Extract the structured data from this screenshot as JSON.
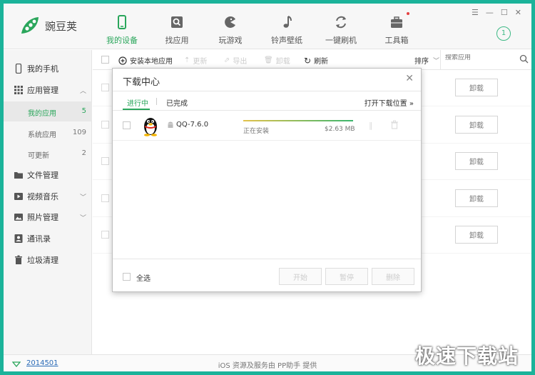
{
  "app": {
    "name": "豌豆荚"
  },
  "nav": {
    "tabs": [
      {
        "label": "我的设备",
        "icon": "phone-icon"
      },
      {
        "label": "找应用",
        "icon": "app-search-icon"
      },
      {
        "label": "玩游戏",
        "icon": "game-pacman-icon"
      },
      {
        "label": "铃声壁纸",
        "icon": "music-note-icon"
      },
      {
        "label": "一键刷机",
        "icon": "refresh-flash-icon"
      },
      {
        "label": "工具箱",
        "icon": "toolbox-icon"
      }
    ],
    "download_count": "1"
  },
  "sidebar": {
    "my_phone": "我的手机",
    "app_manage": "应用管理",
    "sub_items": [
      {
        "label": "我的应用",
        "count": "5"
      },
      {
        "label": "系统应用",
        "count": "109"
      },
      {
        "label": "可更新",
        "count": "2"
      }
    ],
    "file_manage": "文件管理",
    "video_music": "视频音乐",
    "photo_manage": "照片管理",
    "contacts": "通讯录",
    "junk_clean": "垃圾清理"
  },
  "toolbar": {
    "install_local": "安装本地应用",
    "update": "更新",
    "export": "导出",
    "uninstall": "卸载",
    "refresh": "刷新",
    "sort": "排序",
    "search_placeholder": "搜索应用"
  },
  "rows": {
    "uninstall_label": "卸载"
  },
  "dialog": {
    "title": "下载中心",
    "tab_active": "进行中",
    "tab_done": "已完成",
    "open_folder": "打开下载位置",
    "item": {
      "name": "QQ-7.6.0",
      "status": "正在安装",
      "size": "$2.63 MB",
      "progress": 1.0
    },
    "select_all": "全选",
    "btn_start": "开始",
    "btn_pause": "暂停",
    "btn_delete": "删除"
  },
  "status": {
    "version": "2014501",
    "note": "iOS 资源及服务由 PP助手 提供"
  },
  "watermark": "极速下载站",
  "colors": {
    "brand_green": "#2aa65b",
    "frame": "#1bb39a"
  }
}
